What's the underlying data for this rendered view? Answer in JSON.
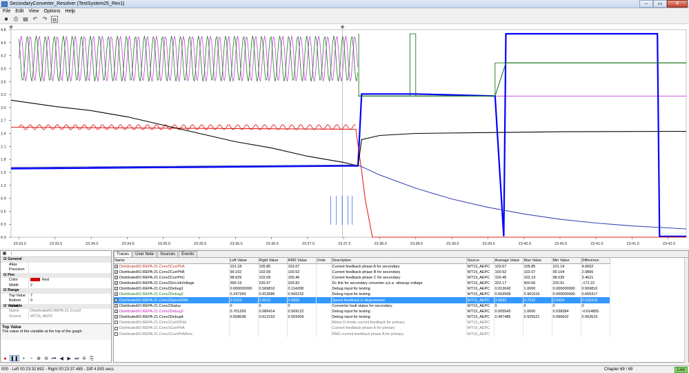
{
  "window": {
    "title": "SecondaryConverter_Resolver (TestSystem25_Rev1)",
    "min": "–",
    "max": "▭",
    "close": "✕"
  },
  "menu": [
    "File",
    "Edit",
    "View",
    "Options",
    "Help"
  ],
  "chart_data": {
    "type": "line",
    "x_ticks": [
      "23:33.0",
      "23:33.5",
      "23:34.0",
      "23:34.5",
      "23:35.0",
      "23:35.5",
      "23:36.0",
      "23:36.5",
      "23:37.0",
      "23:37.5",
      "23:38.0",
      "23:38.5",
      "23:39.0",
      "23:39.5",
      "23:40.0",
      "23:40.5",
      "23:41.0",
      "23:41.5",
      "23:42.0"
    ],
    "y_ticks": [
      "4.8",
      "4.5",
      "4.2",
      "3.9",
      "3.6",
      "3.3",
      "3.0",
      "2.7",
      "2.4",
      "2.1",
      "1.8",
      "1.5",
      "1.2",
      "0.9",
      "0.6",
      "0.3",
      "0.0"
    ],
    "ylim": [
      0,
      5
    ],
    "xlim": [
      32.89,
      42.25
    ],
    "cursor_left": "23:32.892",
    "cursor_right": "23:37.485",
    "series": [
      {
        "name": "DistributedIO.REPA-21.Conv2SpeedFBK",
        "color": "#0000ff",
        "points": [
          [
            32.89,
            1.65
          ],
          [
            37.7,
            1.72
          ],
          [
            37.75,
            3.45
          ],
          [
            38.5,
            3.45
          ],
          [
            39.6,
            3.4
          ],
          [
            39.72,
            0.02
          ],
          [
            39.75,
            4.9
          ],
          [
            41.85,
            4.9
          ],
          [
            41.88,
            0.02
          ],
          [
            42.25,
            0.02
          ]
        ]
      },
      {
        "name": "DistributedIO.REPA-21.Conv2CurrPhA",
        "color": "#e02020",
        "points": [
          [
            32.89,
            2.65
          ],
          [
            37.67,
            2.6
          ],
          [
            37.75,
            1.6
          ],
          [
            37.8,
            0.9
          ],
          [
            37.9,
            0.0
          ],
          [
            42.25,
            0.0
          ]
        ]
      },
      {
        "name": "DistributedIO.REPA-21.Conv2DcLinkVoltage",
        "color": "#000000",
        "points": [
          [
            32.89,
            3.3
          ],
          [
            33.5,
            3.15
          ],
          [
            34.0,
            3.05
          ],
          [
            34.5,
            2.9
          ],
          [
            35.0,
            2.7
          ],
          [
            35.5,
            2.5
          ],
          [
            36.0,
            2.3
          ],
          [
            36.5,
            2.15
          ],
          [
            37.0,
            1.95
          ],
          [
            37.5,
            1.8
          ],
          [
            37.7,
            1.72
          ],
          [
            37.75,
            2.35
          ],
          [
            38.0,
            2.45
          ],
          [
            38.5,
            2.5
          ],
          [
            39.5,
            2.52
          ],
          [
            40.5,
            2.54
          ],
          [
            42.25,
            2.55
          ]
        ]
      },
      {
        "name": "DistributedIO.REPA-21.Conv2CurrPhB",
        "color": "#3b46b8",
        "points": [
          [
            32.89,
            1.68
          ],
          [
            37.7,
            1.74
          ],
          [
            38.0,
            1.5
          ],
          [
            38.5,
            1.18
          ],
          [
            39.0,
            0.92
          ],
          [
            39.5,
            0.72
          ],
          [
            40.0,
            0.56
          ],
          [
            40.5,
            0.43
          ],
          [
            41.0,
            0.34
          ],
          [
            41.5,
            0.27
          ],
          [
            42.25,
            0.2
          ]
        ]
      },
      {
        "name": "DistributedIO.REPA-21.Conv2Debug1",
        "color": "#1a7a1a",
        "points": [
          [
            37.71,
            3.4
          ],
          [
            38.4,
            3.4
          ],
          [
            39.6,
            3.4
          ],
          [
            39.75,
            4.2
          ],
          [
            42.25,
            4.2
          ]
        ]
      }
    ]
  },
  "properties": {
    "groups": [
      {
        "name": "General",
        "rows": [
          [
            "Alias",
            ""
          ],
          [
            "Precision",
            ""
          ]
        ]
      },
      {
        "name": "Pen",
        "rows": [
          [
            "Color",
            "Red"
          ],
          [
            "Width",
            "2"
          ]
        ]
      },
      {
        "name": "Range",
        "rows": [
          [
            "Top Value",
            "7"
          ],
          [
            "Bottom Value",
            "0"
          ]
        ]
      },
      {
        "name": "Variable",
        "rows": [
          [
            "Name",
            "DistributedIO.REPA-21.Conv2"
          ],
          [
            "Source",
            "WT19_AEPC"
          ]
        ]
      }
    ],
    "desc_title": "Top Value",
    "desc_text": "The value of the variable at the top of the graph."
  },
  "tabs": [
    "Traces",
    "User Note",
    "Sources",
    "Events"
  ],
  "columns": [
    "Name",
    "Left Value",
    "Right Value",
    "RMS Value",
    "Units",
    "Description",
    "Source",
    "Average Value",
    "Max Value",
    "Min Value",
    "Difference"
  ],
  "rows": [
    {
      "c": true,
      "n": "DistributedIO.REPA-21.Conv2CurrPhA",
      "col": "#c03020",
      "v": [
        "101.18",
        "105.85",
        "103.67",
        "",
        "Current feedback phase A for secondary",
        "WT19_AEPC",
        "103.67",
        "105.85",
        "101.14",
        "4.6662"
      ]
    },
    {
      "c": true,
      "n": "DistributedIO.REPA-21.Conv2CurrPhB",
      "col": "#000",
      "v": [
        "99.102",
        "102.09",
        "100.52",
        "",
        "Current feedback phase B for secondary",
        "WT19_AEPC",
        "100.52",
        "102.07",
        "99.104",
        "2.9866"
      ]
    },
    {
      "c": true,
      "n": "DistributedIO.REPA-21.Conv2CurrPhC",
      "col": "#000",
      "v": [
        "98.629",
        "102.09",
        "100.46",
        "",
        "Current feedback phase C for secondary",
        "WT19_AEPC",
        "100.45",
        "102.13",
        "98.635",
        "3.4621"
      ]
    },
    {
      "c": true,
      "n": "DistributedIO.REPA-21.Conv2DcLinkVoltage",
      "col": "#000",
      "v": [
        "399.19",
        "226.97",
        "326.82",
        "",
        "Dc link for secondary converter a.k.a. ultracap voltage",
        "WT19_AEPC",
        "323.17",
        "400.66",
        "220.61",
        "-172.22"
      ]
    },
    {
      "c": true,
      "n": "DistributedIO.REPA-21.Conv2Debug1",
      "col": "#000",
      "v": [
        "0.000000000",
        "0.569810",
        "0.114208",
        "",
        "Debug input for testing",
        "WT19_AEPC",
        "0.013043",
        "1.0000",
        "0.000000000",
        "0.569810"
      ]
    },
    {
      "c": true,
      "n": "DistributedIO.REPA-21.Conv2Debug2",
      "col": "#1a7a1a",
      "v": [
        "0.247269",
        "0.913586",
        "0.566152",
        "",
        "Debug input for testing",
        "WT19_AEPC",
        "0.503968",
        "0.961616",
        "0.000000000",
        "0.666317"
      ]
    },
    {
      "c": true,
      "n": "DistributedIO.REPA-21.Conv2SpeedFBK",
      "col": "#fff",
      "sel": true,
      "v": [
        "3.6319",
        "3.6522",
        "3.6895",
        "",
        "Speed feedback in degrees/sec",
        "WT19_AEPC",
        "3.6892",
        "3.7622",
        "3.5924",
        "0.020316"
      ]
    },
    {
      "c": true,
      "n": "DistributedIO.REPA-21.Conv2Status",
      "col": "#000",
      "v": [
        "0",
        "0",
        "0",
        "",
        "Converter fault status for secondary",
        "WT19_AEPC",
        "0",
        "0",
        "0",
        "0"
      ]
    },
    {
      "c": true,
      "n": "DistributedIO.REPA-21.Conv2Debug3",
      "col": "#c020c0",
      "v": [
        "0.701269",
        "0.086414",
        "0.569122",
        "",
        "Debug input for testing",
        "WT19_AEPC",
        "0.505543",
        "1.0000",
        "0.038384",
        "-0.614855"
      ]
    },
    {
      "c": true,
      "n": "DistributedIO.REPA-21.Conv2Debug4",
      "col": "#000",
      "v": [
        "0.558638",
        "0.612153",
        "0.559309",
        "",
        "Debug input for testing",
        "WT19_AEPC",
        "0.497485",
        "0.925521",
        "0.095602",
        "0.053515"
      ]
    },
    {
      "c": false,
      "n": "DistributedIO.REPA-21.Conv1CurrDFbk",
      "col": "#777",
      "grey": true,
      "v": [
        "",
        "",
        "",
        "",
        "Motor D-mode current feedback for primary",
        "WT19_AEPC",
        "",
        "",
        "",
        ""
      ]
    },
    {
      "c": false,
      "n": "DistributedIO.REPA-21.Conv1CurrPhA",
      "col": "#777",
      "grey": true,
      "v": [
        "",
        "",
        "",
        "",
        "Current feedback phase A for primary",
        "WT19_AEPC",
        "",
        "",
        "",
        ""
      ]
    },
    {
      "c": false,
      "n": "DistributedIO.REPA-21.Conv1CurrPhARms",
      "col": "#777",
      "grey": true,
      "v": [
        "",
        "",
        "",
        "",
        "RMS current feedback phase A for primary",
        "WT19_AEPC",
        "",
        "",
        "",
        ""
      ]
    }
  ],
  "status": {
    "left": "000 - Left 00:23:32.892 - Right 00:23:37.485 - Diff 4.593 secs",
    "chapter": "Chapter 69 / 69",
    "live": "Live"
  }
}
